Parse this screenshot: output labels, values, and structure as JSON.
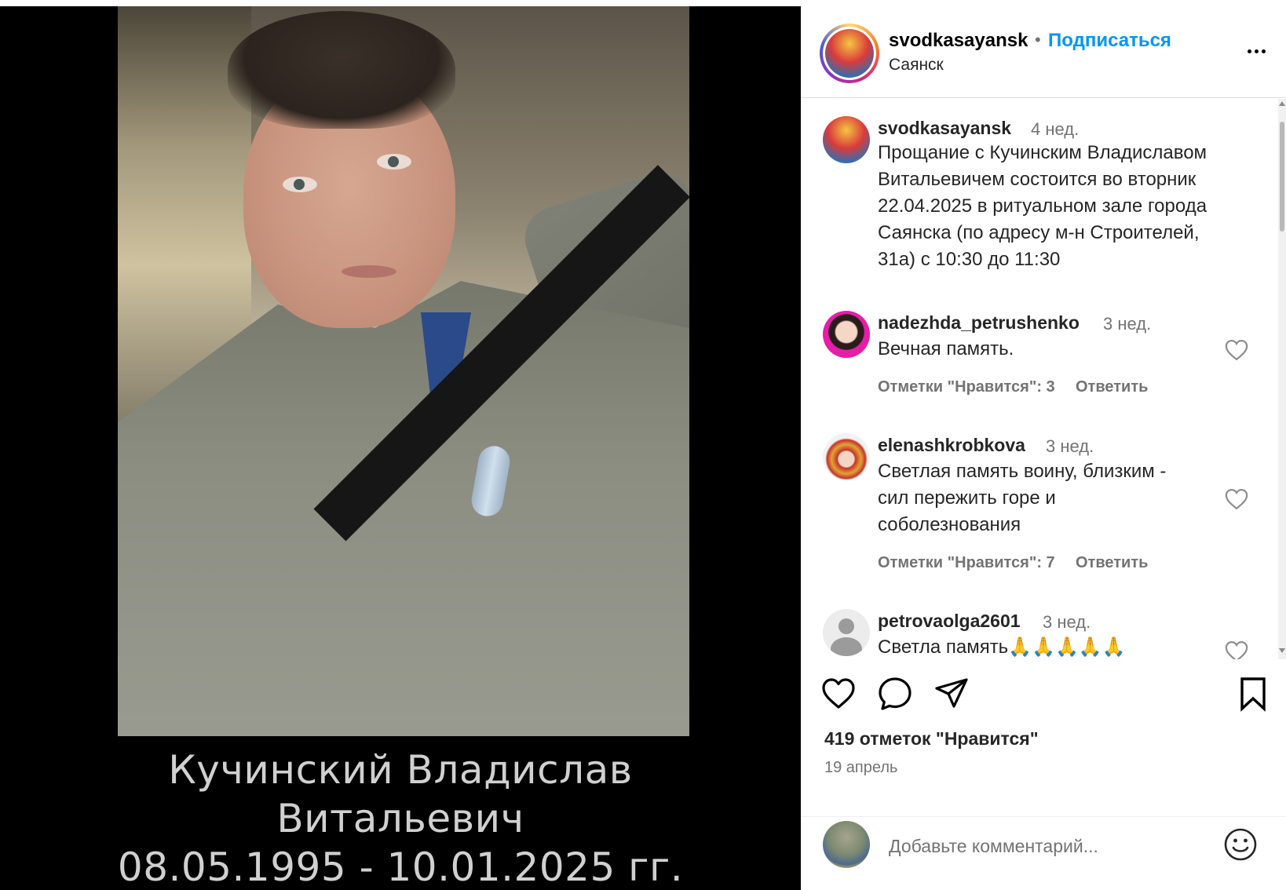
{
  "post": {
    "caption_lines": [
      "Кучинский Владислав",
      "Витальевич",
      "08.05.1995 - 10.01.2025 гг."
    ]
  },
  "header": {
    "username": "svodkasayansk",
    "separator": "•",
    "follow_label": "Подписаться",
    "location": "Саянск"
  },
  "caption": {
    "username": "svodkasayansk",
    "time": "4 нед.",
    "lines": [
      "Прощание с Кучинским Владиславом",
      "Витальевичем состоится во вторник",
      "22.04.2025 в ритуальном зале города",
      "Саянска (по адресу м-н Строителей,",
      "31а) с 10:30 до 11:30"
    ]
  },
  "comments": [
    {
      "username": "nadezhda_petrushenko",
      "time": "3 нед.",
      "lines": [
        "Вечная память."
      ],
      "likes_label": "Отметки \"Нравится\": 3",
      "reply_label": "Ответить"
    },
    {
      "username": "elenashkrobkova",
      "time": "3 нед.",
      "lines": [
        "Светлая память воину, близким -",
        "сил пережить горе и",
        "соболезнования"
      ],
      "likes_label": "Отметки \"Нравится\": 7",
      "reply_label": "Ответить"
    },
    {
      "username": "petrovaolga2601",
      "time": "3 нед.",
      "lines": [
        "Светла память🙏🙏🙏🙏🙏"
      ]
    }
  ],
  "footer": {
    "likes": "419 отметок \"Нравится\"",
    "date": "19 апрель",
    "comment_placeholder": "Добавьте комментарий..."
  },
  "icons": {
    "like": "heart-icon",
    "comment": "comment-bubble-icon",
    "share": "paper-plane-icon",
    "save": "bookmark-icon",
    "more": "more-options-icon",
    "emoji": "emoji-icon"
  },
  "colors": {
    "accent": "#0095f6",
    "muted": "#737373",
    "text": "#262626"
  }
}
